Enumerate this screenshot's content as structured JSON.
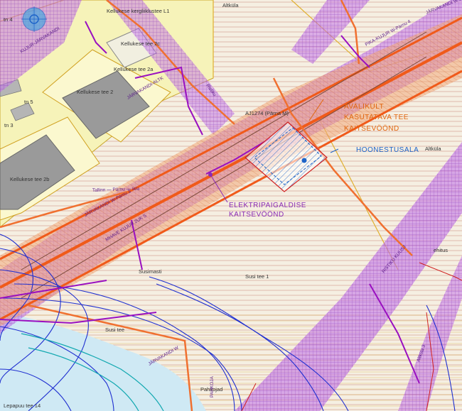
{
  "map": {
    "annotations": {
      "public_use": [
        "AVALIKULT",
        "KASUTATAVA TEE",
        "KAITSEVÖÖND"
      ],
      "building_area": "HOONESTUSALA",
      "electric": [
        "ELEKTRIPAIGALDISE",
        "KAITSEVÖÖND"
      ]
    },
    "place_labels": {
      "kellukese_l1": "Kellukese kergliiklustee L1",
      "altkula_top": "Altküla",
      "altkula_right": "Altküla",
      "kellukese_2a": "Kellukese tee 2a",
      "kellukese_2": "Kellukese tee 2",
      "kellukese_2b": "Kellukese tee 2b",
      "kellukese_2c": "Kellukese tee 2c",
      "tn4": "tn 4",
      "tn5": "tn 5",
      "tn3": "tn 3",
      "susi1": "Susi tee 1",
      "susimasti": "Susimasti",
      "pahkojad": "Pahkojad",
      "lepapuu14": "Lepapuu tee 14",
      "ehitus": "ehitus",
      "susi_tee": "Susi tee",
      "aj": "AJ1274 (Pärna M)",
      "tall": "Tallinn — Pärnu — Ikla",
      "mk1": "JÄRVAKANDI W-Pärnu 3",
      "mk2": "MHAVE KUJUR 2UK S",
      "mk3": "PIKA-KUJUR W-Pärnu 4",
      "mk4": "KUJUR-JÄRVAKANDI",
      "mk5": "RISTIKU KUUSJ",
      "mk6": "JÄRVAKANDI W 3VN",
      "mk7": "JÄRVAKANDI-ALTK",
      "mk8": "Ristiku",
      "mk9": "Altküla 3",
      "mk10": "PAHKOJA",
      "mk11": "JÄRVAKANDI W"
    },
    "colors": {
      "background": "#f5f0e4",
      "parcel_yellow": "#f6f3b9",
      "road_orange": "#f08030",
      "purple_zone": "#9a35c8",
      "water": "#cfe9f4",
      "building_blue": "#1e64c8",
      "blue_lines": "#1f2fd0",
      "annotation_orange": "#e2660e",
      "annotation_purple": "#8a2bb5"
    }
  }
}
